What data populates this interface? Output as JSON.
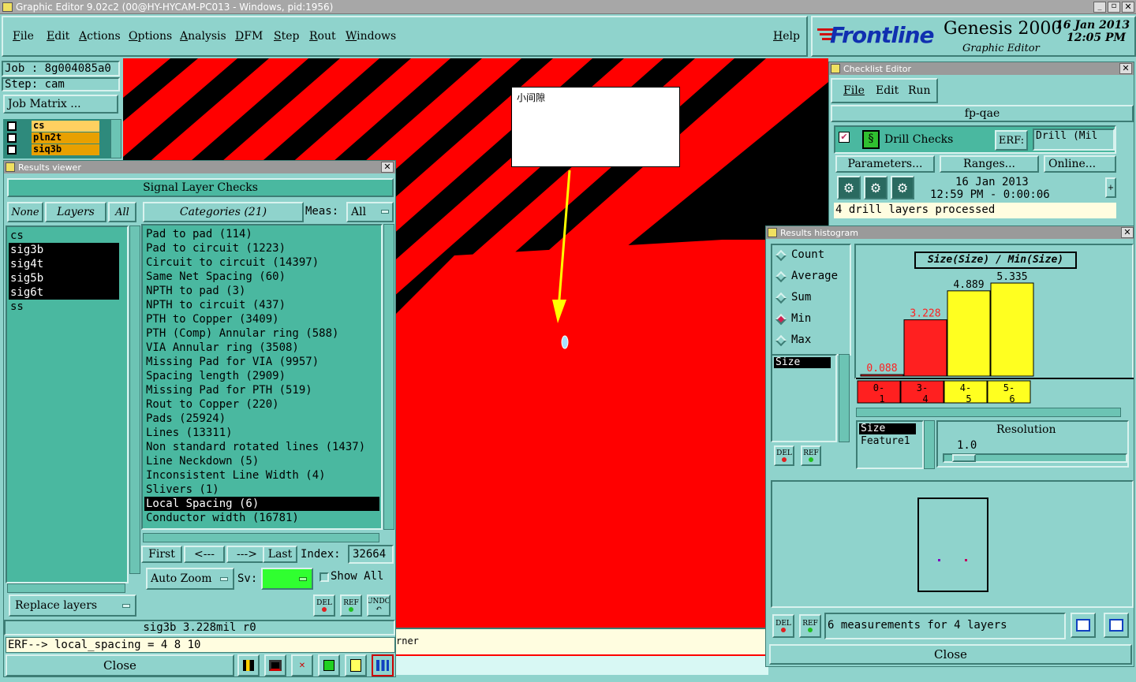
{
  "titlebar": {
    "text": "Graphic Editor 9.02c2 (00@HY-HYCAM-PC013 - Windows, pid:1956)"
  },
  "menu": [
    "File",
    "Edit",
    "Actions",
    "Options",
    "Analysis",
    "DFM",
    "Step",
    "Rout",
    "Windows"
  ],
  "help": "Help",
  "brand": {
    "logo": "Frontline",
    "product": "Genesis 2000",
    "subtitle": "Graphic Editor",
    "date": "16 Jan 2013",
    "time": "12:05 PM"
  },
  "job": {
    "job_label": "Job : 8g004085a0",
    "step_label": "Step: cam",
    "matrix_button": "Job Matrix ...",
    "layers": [
      {
        "name": "cs",
        "color": "#ffd060"
      },
      {
        "name": "pln2t",
        "color": "#e8a000"
      },
      {
        "name": "siq3b",
        "color": "#e8a000"
      }
    ]
  },
  "canvas": {
    "note_text": "小间隙",
    "status_fragment": "rner"
  },
  "results_viewer": {
    "title": "Results viewer",
    "header": "Signal Layer Checks",
    "none_btn": "None",
    "layers_btn": "Layers",
    "all_btn": "All",
    "categories_btn": "Categories (21)",
    "meas_label": "Meas:",
    "meas_value": "All",
    "layers": [
      {
        "name": "cs",
        "selected": false
      },
      {
        "name": "sig3b",
        "selected": true
      },
      {
        "name": "sig4t",
        "selected": true
      },
      {
        "name": "sig5b",
        "selected": true
      },
      {
        "name": "sig6t",
        "selected": true
      },
      {
        "name": "ss",
        "selected": false
      }
    ],
    "categories": [
      {
        "name": "Pad to pad (114)",
        "selected": false
      },
      {
        "name": "Pad to circuit (1223)",
        "selected": false
      },
      {
        "name": "Circuit to circuit (14397)",
        "selected": false
      },
      {
        "name": "Same Net Spacing (60)",
        "selected": false
      },
      {
        "name": "NPTH to pad (3)",
        "selected": false
      },
      {
        "name": "NPTH to circuit (437)",
        "selected": false
      },
      {
        "name": "PTH to Copper (3409)",
        "selected": false
      },
      {
        "name": "PTH (Comp) Annular ring (588)",
        "selected": false
      },
      {
        "name": "VIA Annular ring (3508)",
        "selected": false
      },
      {
        "name": "Missing Pad for VIA (9957)",
        "selected": false
      },
      {
        "name": "Spacing length (2909)",
        "selected": false
      },
      {
        "name": "Missing Pad for PTH (519)",
        "selected": false
      },
      {
        "name": "Rout to Copper (220)",
        "selected": false
      },
      {
        "name": "Pads (25924)",
        "selected": false
      },
      {
        "name": "Lines (13311)",
        "selected": false
      },
      {
        "name": "Non standard rotated lines (1437)",
        "selected": false
      },
      {
        "name": "Line Neckdown (5)",
        "selected": false
      },
      {
        "name": "Inconsistent Line Width (4)",
        "selected": false
      },
      {
        "name": "Slivers (1)",
        "selected": false
      },
      {
        "name": "Local Spacing (6)",
        "selected": true
      },
      {
        "name": "Conductor width (16781)",
        "selected": false
      }
    ],
    "nav": {
      "first": "First",
      "prev": "<---",
      "next": "--->",
      "last": "Last",
      "index_label": "Index:",
      "index_value": "32664"
    },
    "auto_zoom": "Auto Zoom",
    "sv_label": "Sv:",
    "show_all": "Show All",
    "replace_layers": "Replace layers",
    "del": "DEL",
    "ref": "REF",
    "undo": "UNDO",
    "status": "sig3b 3.228mil  r0",
    "erf_line": "ERF--> local_spacing = 4 8 10",
    "close": "Close"
  },
  "checklist": {
    "title": "Checklist Editor",
    "menu": [
      "File",
      "Edit",
      "Run"
    ],
    "name": "fp-qae",
    "check_name": "Drill Checks",
    "erf_label": "ERF:",
    "erf_value": "Drill (Mil",
    "parameters_btn": "Parameters...",
    "ranges_btn": "Ranges...",
    "online_btn": "Online...",
    "date": "16 Jan 2013",
    "time": "12:59 PM - 0:00:06",
    "message": "4 drill layers processed"
  },
  "histogram": {
    "title": "Results histogram",
    "modes": [
      {
        "label": "Count",
        "selected": false
      },
      {
        "label": "Average",
        "selected": false
      },
      {
        "label": "Sum",
        "selected": false
      },
      {
        "label": "Min",
        "selected": true
      },
      {
        "label": "Max",
        "selected": false
      }
    ],
    "size_list": [
      "Size"
    ],
    "sort_list": [
      "Size",
      "Feature1"
    ],
    "resolution_label": "Resolution",
    "resolution_value": "1.0",
    "del": "DEL",
    "ref": "REF",
    "measurements": "6 measurements for 4 layers",
    "close": "Close",
    "chart_data": {
      "type": "bar",
      "title": "Size(Size) / Min(Size)",
      "categories": [
        "0-1",
        "3-4",
        "4-5",
        "5-6"
      ],
      "category_labels": [
        [
          "0-",
          "1"
        ],
        [
          "3-",
          "4"
        ],
        [
          "4-",
          "5"
        ],
        [
          "5-",
          "6"
        ]
      ],
      "values": [
        0.088,
        3.228,
        4.889,
        5.335
      ],
      "value_labels": [
        "0.088",
        "3.228",
        "4.889",
        "5.335"
      ],
      "colors": [
        "#ff2020",
        "#ff2020",
        "#ffff20",
        "#ffff20"
      ],
      "label_colors": [
        "#ff2020",
        "#ff2020",
        "#000000",
        "#000000"
      ],
      "ylim": [
        0,
        5.335
      ]
    }
  }
}
